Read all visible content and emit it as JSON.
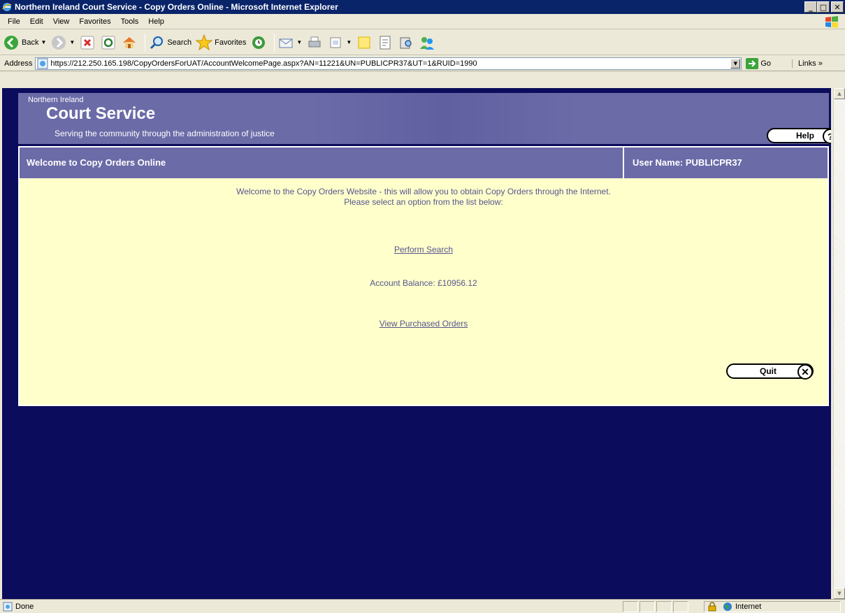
{
  "window": {
    "title": "Northern Ireland Court Service - Copy Orders Online - Microsoft Internet Explorer",
    "minimize": "_",
    "maximize": "□",
    "close": "✕"
  },
  "menubar": {
    "items": [
      {
        "label": "File"
      },
      {
        "label": "Edit"
      },
      {
        "label": "View"
      },
      {
        "label": "Favorites"
      },
      {
        "label": "Tools"
      },
      {
        "label": "Help"
      }
    ]
  },
  "toolbar": {
    "back_label": "Back",
    "search_label": "Search",
    "favorites_label": "Favorites"
  },
  "addressbar": {
    "label": "Address",
    "url": "https://212.250.165.198/CopyOrdersForUAT/AccountWelcomePage.aspx?AN=11221&UN=PUBLICPR37&UT=1&RUID=1990",
    "go_label": "Go",
    "links_label": "Links »"
  },
  "banner": {
    "small": "Northern Ireland",
    "big": "Court Service",
    "tagline": "Serving the community through the administration of justice",
    "help_label": "Help",
    "help_icon": "?"
  },
  "panel": {
    "title": "Welcome to Copy Orders Online",
    "user": "User Name:  PUBLICPR37",
    "welcome_line1": "Welcome to the Copy Orders Website - this will allow you to obtain Copy Orders through the Internet.",
    "welcome_line2": "Please select an option from the list below:",
    "perform_search": "Perform Search",
    "balance": "Account Balance: £10956.12",
    "view_purchased": "View Purchased Orders",
    "quit_label": "Quit",
    "quit_icon": "✕"
  },
  "statusbar": {
    "status": "Done",
    "zone": "Internet"
  },
  "colors": {
    "title_bar": "#0a246a",
    "page_bg": "#0c0c5c",
    "header": "#6b6ba8",
    "panel_bg": "#ffffcc",
    "link": "#55558e"
  }
}
